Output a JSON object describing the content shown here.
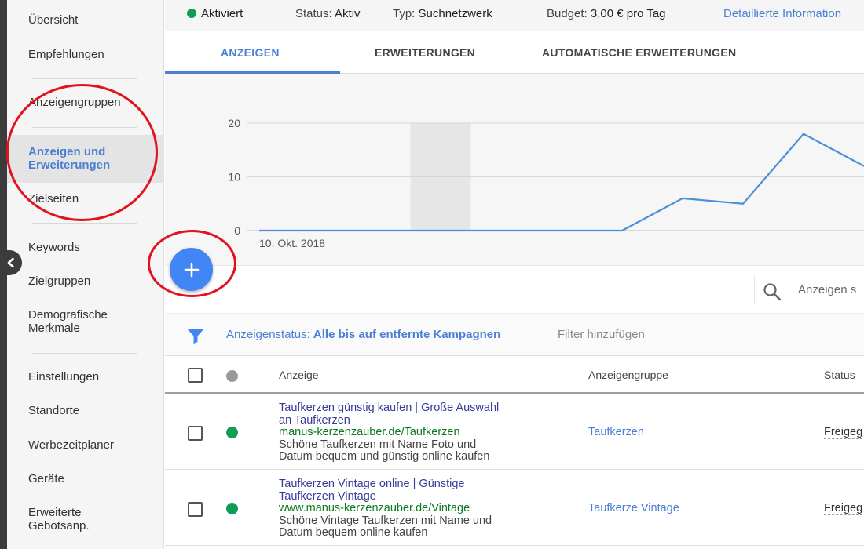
{
  "sidebar": {
    "items": [
      {
        "label": "Übersicht"
      },
      {
        "label": "Empfehlungen"
      },
      {
        "label": "Anzeigengruppen"
      },
      {
        "label": "Anzeigen und Erweiterungen",
        "active": true
      },
      {
        "label": "Zielseiten"
      },
      {
        "label": "Keywords"
      },
      {
        "label": "Zielgruppen"
      },
      {
        "label": "Demografische Merkmale"
      },
      {
        "label": "Einstellungen"
      },
      {
        "label": "Standorte"
      },
      {
        "label": "Werbezeitplaner"
      },
      {
        "label": "Geräte"
      },
      {
        "label": "Erweiterte Gebotsanp."
      }
    ]
  },
  "status_bar": {
    "state": "Aktiviert",
    "status_label": "Status:",
    "status_value": "Aktiv",
    "type_label": "Typ:",
    "type_value": "Suchnetzwerk",
    "budget_label": "Budget:",
    "budget_value": "3,00 € pro Tag",
    "details_link": "Detaillierte Information"
  },
  "tabs": [
    {
      "label": "ANZEIGEN",
      "active": true
    },
    {
      "label": "ERWEITERUNGEN"
    },
    {
      "label": "AUTOMATISCHE ERWEITERUNGEN"
    }
  ],
  "chart_data": {
    "type": "line",
    "y_ticks": [
      "20",
      "10",
      "0"
    ],
    "ylim": [
      0,
      20
    ],
    "x_start_label": "10. Okt. 2018",
    "x_index": [
      0,
      1,
      2,
      3,
      4,
      5,
      6,
      7,
      8,
      9,
      10
    ],
    "values": [
      0,
      0,
      0,
      0,
      0,
      0,
      0,
      6,
      5,
      18,
      12
    ],
    "highlight_x": 3,
    "line_color": "#4a90d9",
    "grid": true
  },
  "search": {
    "placeholder": "Anzeigen s"
  },
  "filter": {
    "label": "Anzeigenstatus:",
    "value": "Alle bis auf entfernte Kampagnen",
    "add": "Filter hinzufügen"
  },
  "table": {
    "headers": {
      "ad": "Anzeige",
      "adgroup": "Anzeigengruppe",
      "status": "Status"
    },
    "rows": [
      {
        "headline1": "Taufkerzen günstig kaufen | Große Auswahl",
        "headline2": "an Taufkerzen",
        "url": "manus-kerzenzauber.de/Taufkerzen",
        "desc1": "Schöne Taufkerzen mit Name Foto und",
        "desc2": "Datum bequem und günstig online kaufen",
        "adgroup": "Taufkerzen",
        "status": "Freigeg"
      },
      {
        "headline1": "Taufkerzen Vintage online | Günstige",
        "headline2": "Taufkerzen Vintage",
        "url": "www.manus-kerzenzauber.de/Vintage",
        "desc1": "Schöne Vintage Taufkerzen mit Name und",
        "desc2": "Datum bequem online kaufen",
        "adgroup": "Taufkerze Vintage",
        "status": "Freigeg"
      }
    ]
  },
  "colors": {
    "accent": "#4a7fd4",
    "fab": "#4285f4",
    "enabled_dot": "#0f9d58",
    "annotation": "#e0141e"
  }
}
